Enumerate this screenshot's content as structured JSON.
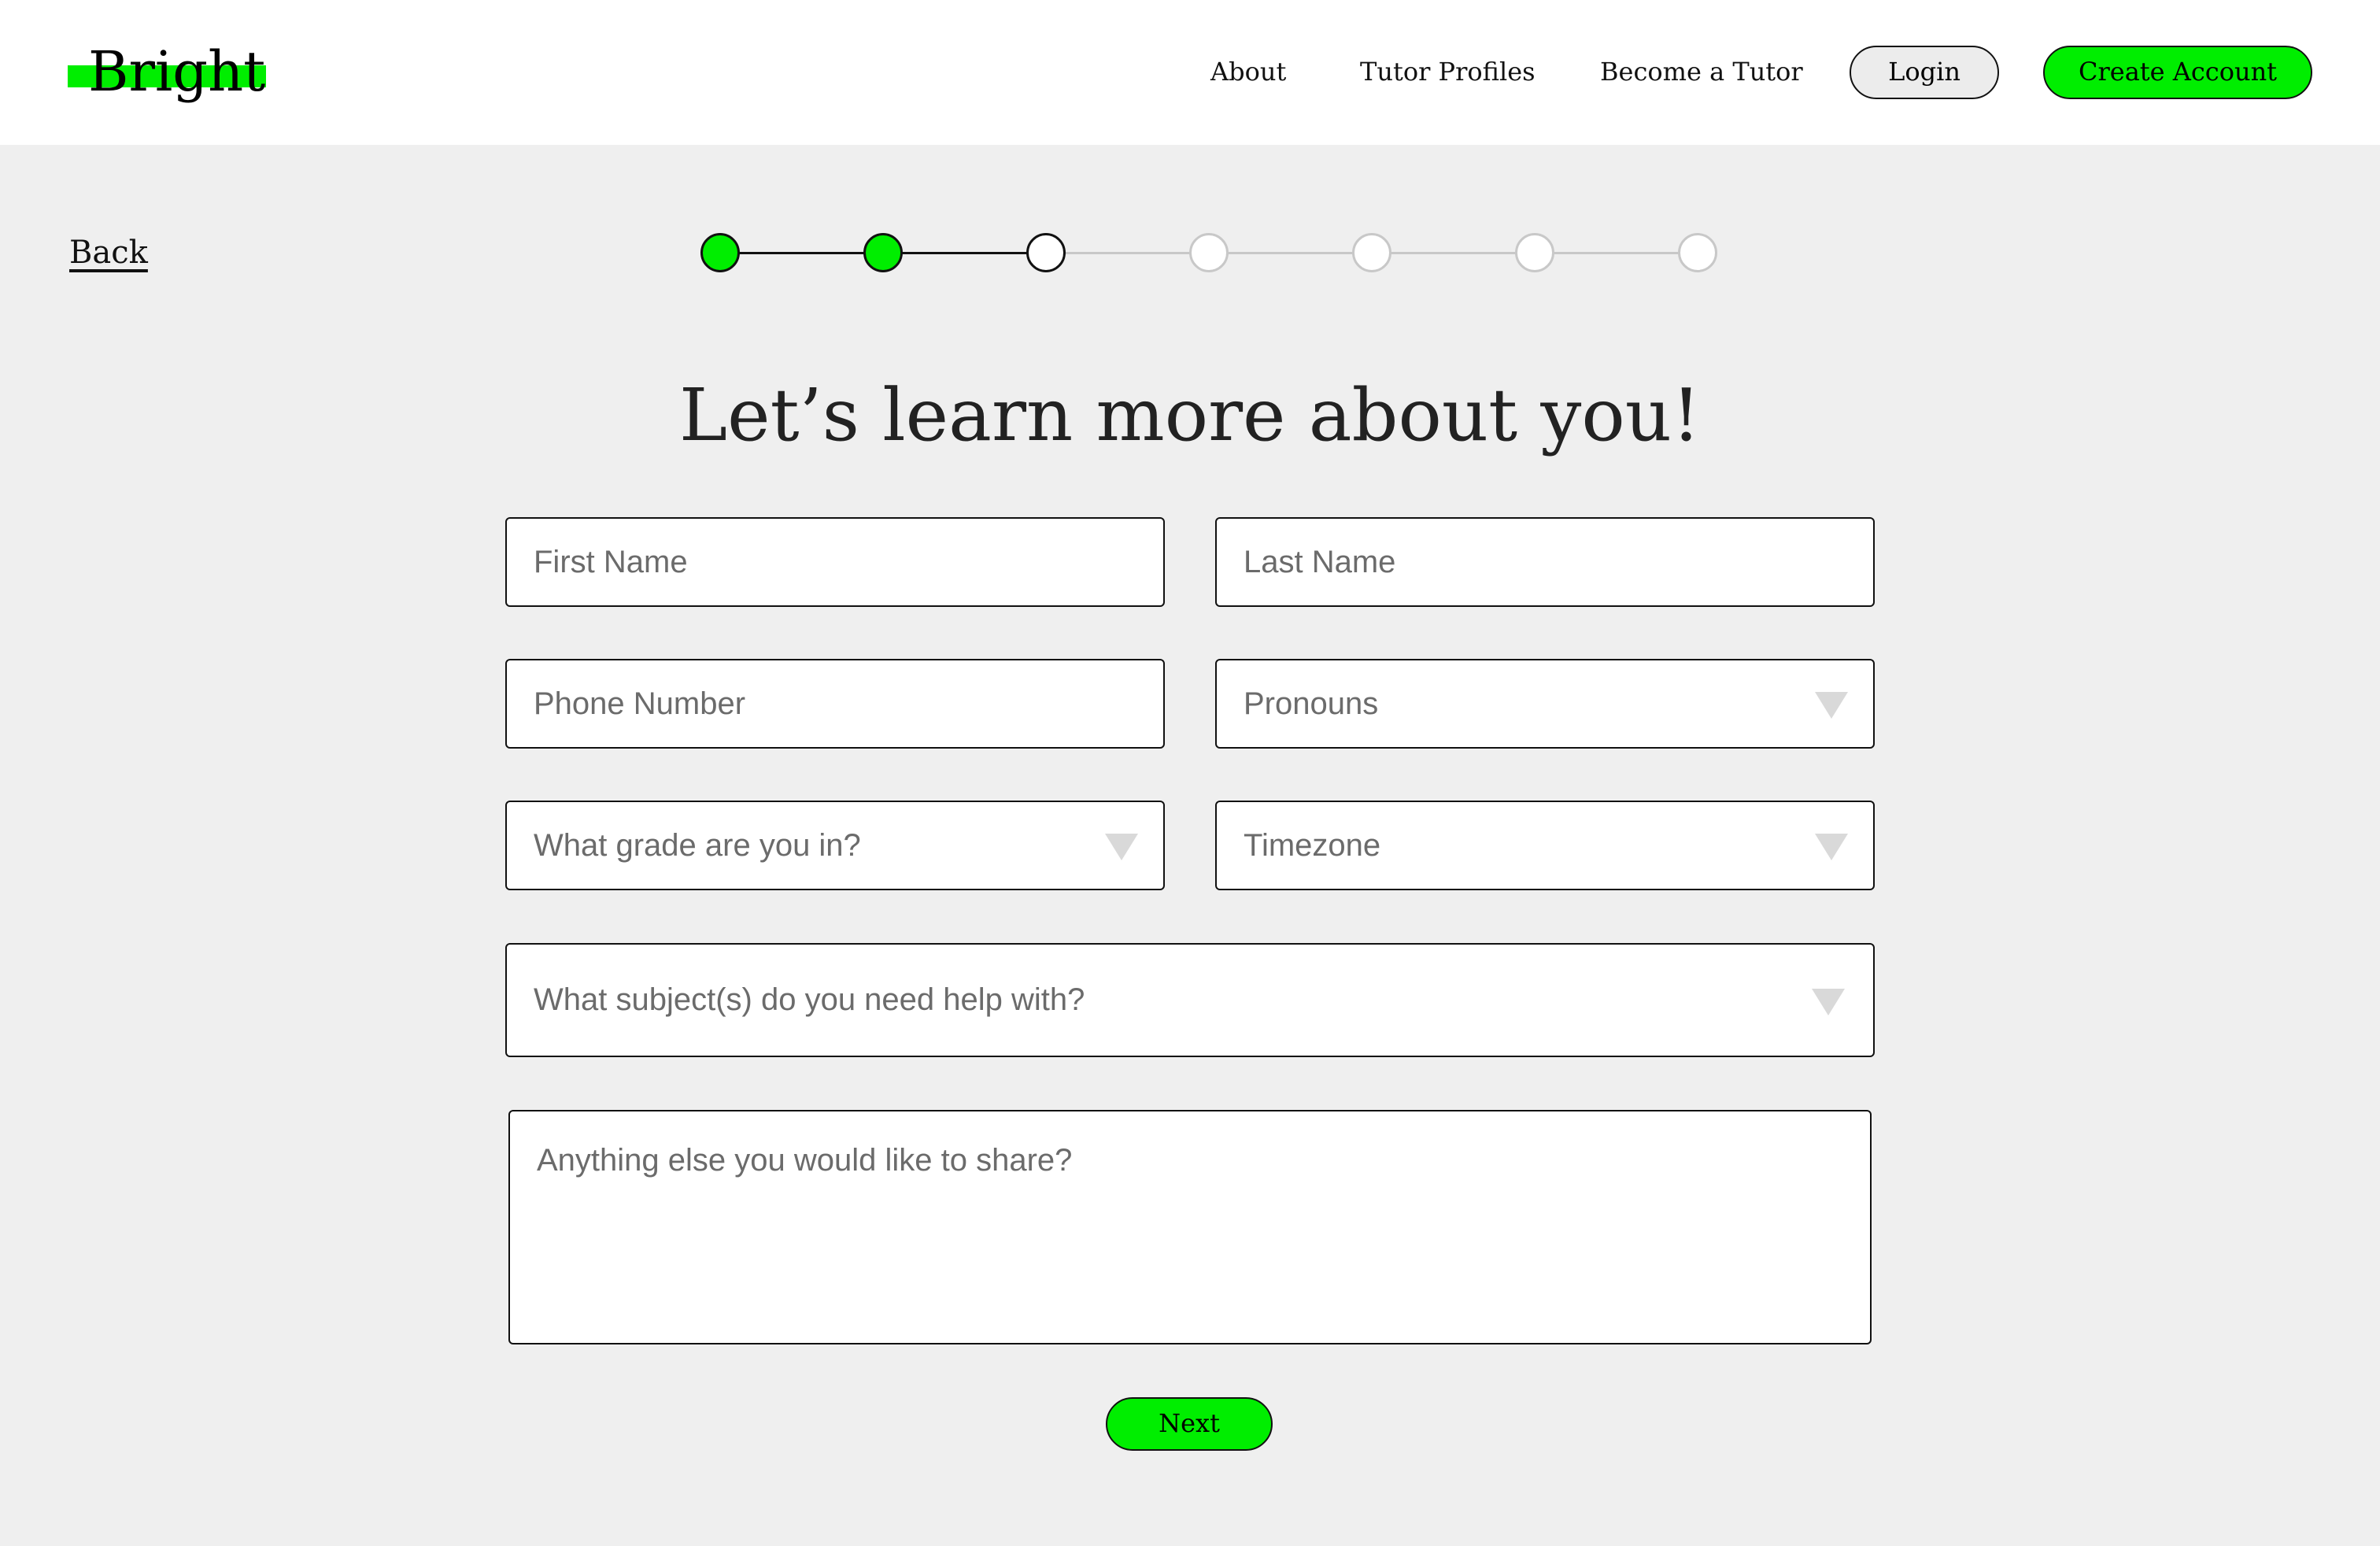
{
  "brand": {
    "name": "Bright",
    "accent_color": "#00ee00"
  },
  "nav": {
    "items": [
      {
        "label": "About"
      },
      {
        "label": "Tutor Profiles"
      },
      {
        "label": "Become a Tutor"
      }
    ],
    "login_label": "Login",
    "create_account_label": "Create Account"
  },
  "back_label": "Back",
  "stepper": {
    "total_steps": 7,
    "completed_steps": 2,
    "current_step": 3
  },
  "heading": "Let’s learn more about you!",
  "form": {
    "first_name": {
      "placeholder": "First Name",
      "value": ""
    },
    "last_name": {
      "placeholder": "Last Name",
      "value": ""
    },
    "phone": {
      "placeholder": "Phone Number",
      "value": ""
    },
    "pronouns": {
      "placeholder": "Pronouns",
      "value": "",
      "icon": "chevron-down-icon"
    },
    "grade": {
      "placeholder": "What grade are you in?",
      "value": "",
      "icon": "chevron-down-icon"
    },
    "timezone": {
      "placeholder": "Timezone",
      "value": "",
      "icon": "chevron-down-icon"
    },
    "subjects": {
      "placeholder": "What subject(s) do you need help with?",
      "value": "",
      "icon": "chevron-down-icon"
    },
    "notes": {
      "placeholder": "Anything else you would like to share?",
      "value": ""
    }
  },
  "next_label": "Next"
}
